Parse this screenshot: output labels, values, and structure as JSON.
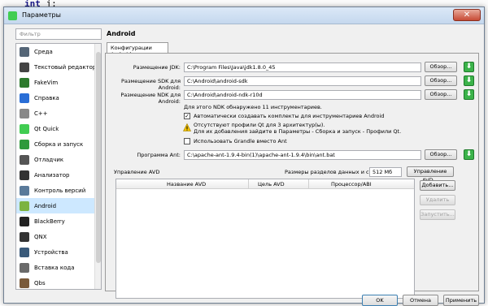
{
  "background": {
    "code_snippet_kw": "int",
    "code_snippet_rest": " j;"
  },
  "window": {
    "title": "Параметры"
  },
  "filter": {
    "placeholder": "Фильтр"
  },
  "sidebar": {
    "items": [
      {
        "label": "Среда",
        "icon": "monitor-icon",
        "color": "#556677"
      },
      {
        "label": "Текстовый редактор",
        "icon": "text-editor-icon",
        "color": "#444444"
      },
      {
        "label": "FakeVim",
        "icon": "fakevim-icon",
        "color": "#2d7a2d"
      },
      {
        "label": "Справка",
        "icon": "help-icon",
        "color": "#2a6ed6"
      },
      {
        "label": "C++",
        "icon": "cpp-icon",
        "color": "#888888"
      },
      {
        "label": "Qt Quick",
        "icon": "qt-quick-icon",
        "color": "#41cd52"
      },
      {
        "label": "Сборка и запуск",
        "icon": "build-run-icon",
        "color": "#2f9a3c"
      },
      {
        "label": "Отладчик",
        "icon": "debugger-icon",
        "color": "#555555"
      },
      {
        "label": "Анализатор",
        "icon": "analyzer-icon",
        "color": "#333333"
      },
      {
        "label": "Контроль версий",
        "icon": "version-control-icon",
        "color": "#5a7a9a"
      },
      {
        "label": "Android",
        "icon": "android-icon",
        "color": "#7cb342",
        "active": true
      },
      {
        "label": "BlackBerry",
        "icon": "blackberry-icon",
        "color": "#222222"
      },
      {
        "label": "QNX",
        "icon": "qnx-icon",
        "color": "#333333"
      },
      {
        "label": "Устройства",
        "icon": "devices-icon",
        "color": "#3a5a7a"
      },
      {
        "label": "Вставка кода",
        "icon": "code-paste-icon",
        "color": "#6a6a6a"
      },
      {
        "label": "Qbs",
        "icon": "qbs-icon",
        "color": "#7a5a3a"
      }
    ]
  },
  "page": {
    "header": "Android",
    "tab": "Конфигурации Android"
  },
  "form": {
    "jdk_label": "Размещение JDK:",
    "jdk_value": "C:\\Program Files\\Java\\jdk1.8.0_45",
    "sdk_label": "Размещение SDK для Android:",
    "sdk_value": "C:\\Android\\android-sdk",
    "ndk_label": "Размещение NDK для Android:",
    "ndk_value": "C:\\Android\\android-ndk-r10d",
    "browse": "Обзор...",
    "ndk_found": "Для этого NDK обнаружено 11 инструментариев.",
    "auto_kits_label": "Автоматически создавать комплекты для инструментариев Android",
    "auto_kits_checked": true,
    "warning_line1": "Отсутствуют профили Qt для 3 архитектур(ы).",
    "warning_line2": "Для их добавления зайдите в Параметры - Сборка и запуск - Профили Qt.",
    "gradle_label": "Использовать Grandle вместо Ant",
    "gradle_checked": false,
    "ant_label": "Программа Ant:",
    "ant_value": "C:\\apache-ant-1.9.4-bin(1)\\apache-ant-1.9.4\\bin\\ant.bat"
  },
  "avd": {
    "title": "Управление AVD",
    "partition_label": "Размеры разделов данных и системы:",
    "partition_value": "512 Мб",
    "manage_button": "Управление AVD...",
    "columns": [
      "Название AVD",
      "Цель AVD",
      "Процессор/ABI"
    ],
    "add_button": "Добавить...",
    "remove_button": "Удалить",
    "start_button": "Запустить..."
  },
  "footer": {
    "ok": "OK",
    "cancel": "Отмена",
    "apply": "Применить"
  }
}
